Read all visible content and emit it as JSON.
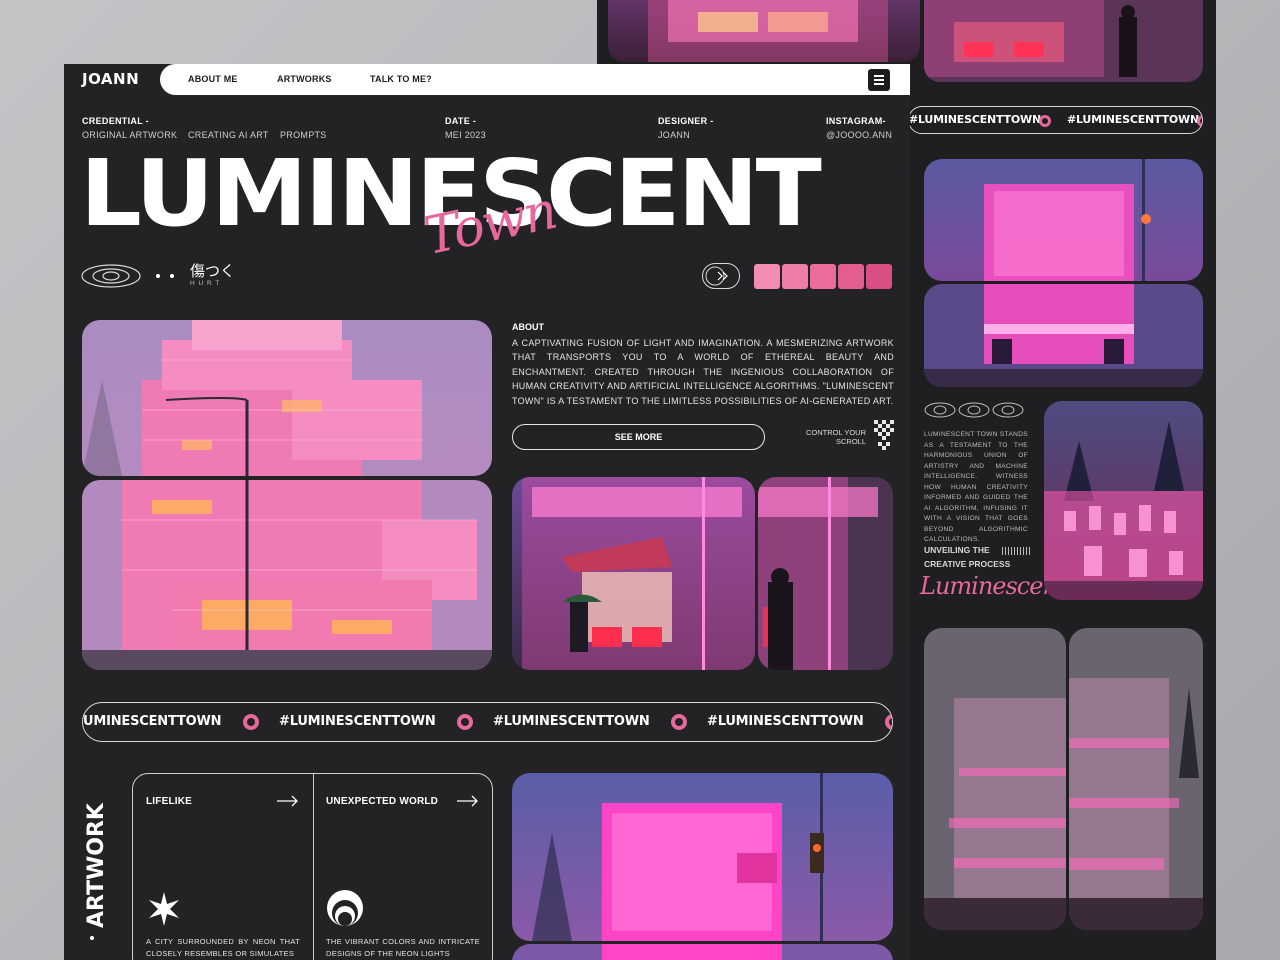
{
  "brand": {
    "logo": "JOANN"
  },
  "nav": {
    "links": [
      "ABOUT ME",
      "ARTWORKS",
      "TALK TO ME?"
    ]
  },
  "meta": {
    "credential": {
      "label": "CREDENTIAL -",
      "values": [
        "ORIGINAL ARTWORK",
        "CREATING AI ART",
        "PROMPTS"
      ]
    },
    "date": {
      "label": "DATE -",
      "value": "MEI 2023"
    },
    "designer": {
      "label": "DESIGNER -",
      "value": "JOANN"
    },
    "instagram": {
      "label": "INSTAGRAM-",
      "value": "@JOOOO.ANN"
    }
  },
  "hero": {
    "title": "LUMINESCENT",
    "script": "Town",
    "jp_text": "傷つく",
    "jp_sub": "H U R T"
  },
  "about": {
    "label": "ABOUT",
    "text": "A CAPTIVATING FUSION OF LIGHT AND IMAGINATION. A MESMERIZING ARTWORK THAT TRANSPORTS YOU TO A WORLD OF ETHEREAL BEAUTY AND ENCHANTMENT. CREATED THROUGH THE INGENIOUS COLLABORATION OF HUMAN CREATIVITY AND ARTIFICIAL INTELLIGENCE ALGORITHMS. \"LUMINESCENT TOWN\" IS A TESTAMENT TO THE LIMITLESS POSSIBILITIES OF AI-GENERATED ART.",
    "button": "SEE MORE",
    "scroll_hint": "CONTROL YOUR SCROLL"
  },
  "palette": [
    "#f28cb5",
    "#f07ca9",
    "#ea6c9c",
    "#e35d90",
    "#d94e84"
  ],
  "ticker": {
    "hashtag": "#LUMINESCENTTOWN",
    "main_items": [
      "UMINESCENTTOWN",
      "#LUMINESCENTTOWN",
      "#LUMINESCENTTOWN",
      "#LUMINESCENTTOWN"
    ],
    "back_items": [
      "#LUMINESCENTTOWN",
      "#LUMINESCENTTOWN"
    ]
  },
  "section": {
    "vertical_title": "ARTWORK",
    "cards": [
      {
        "title": "LIFELIKE",
        "desc": "A CITY SURROUNDED BY NEON THAT CLOSELY RESEMBLES OR SIMULATES"
      },
      {
        "title": "UNEXPECTED WORLD",
        "desc": "THE VIBRANT COLORS AND INTRICATE DESIGNS OF THE NEON LIGHTS"
      }
    ]
  },
  "side": {
    "text": "LUMINESCENT TOWN STANDS AS A TESTAMENT TO THE HARMONIOUS UNION OF ARTISTRY AND MACHINE INTELLIGENCE. WITNESS HOW HUMAN CREATIVITY INFORMED AND GUIDED THE AI ALGORITHM, INFUSING IT WITH A VISION THAT GOES BEYOND ALGORITHMIC CALCULATIONS.",
    "subtitle_line1": "UNVEILING THE",
    "subtitle_line2": "CREATIVE PROCESS",
    "script": "Luminescent"
  },
  "colors": {
    "accent": "#e7689e",
    "bg": "#232325",
    "pink_glow": "#ff5fb0"
  }
}
